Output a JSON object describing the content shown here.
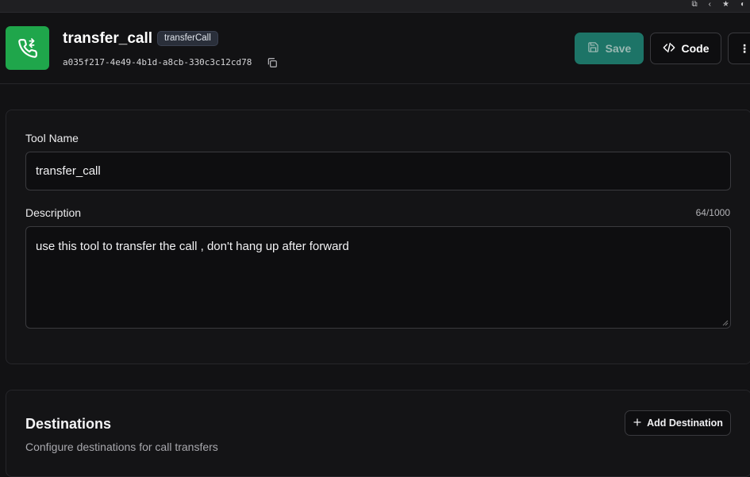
{
  "header": {
    "title": "transfer_call",
    "badge": "transferCall",
    "tool_id": "a035f217-4e49-4b1d-a8cb-330c3c12cd78",
    "icon": "phone-transfer-icon",
    "accent_color": "#1fa64b"
  },
  "actions": {
    "save_label": "Save",
    "code_label": "Code",
    "more_label": "⋮"
  },
  "form": {
    "tool_name_label": "Tool Name",
    "tool_name_value": "transfer_call",
    "description_label": "Description",
    "description_value": "use this tool to transfer the call , don't hang up after forward",
    "description_counter": "64/1000"
  },
  "destinations": {
    "title": "Destinations",
    "subtitle": "Configure destinations for call transfers",
    "add_label": "Add Destination"
  }
}
